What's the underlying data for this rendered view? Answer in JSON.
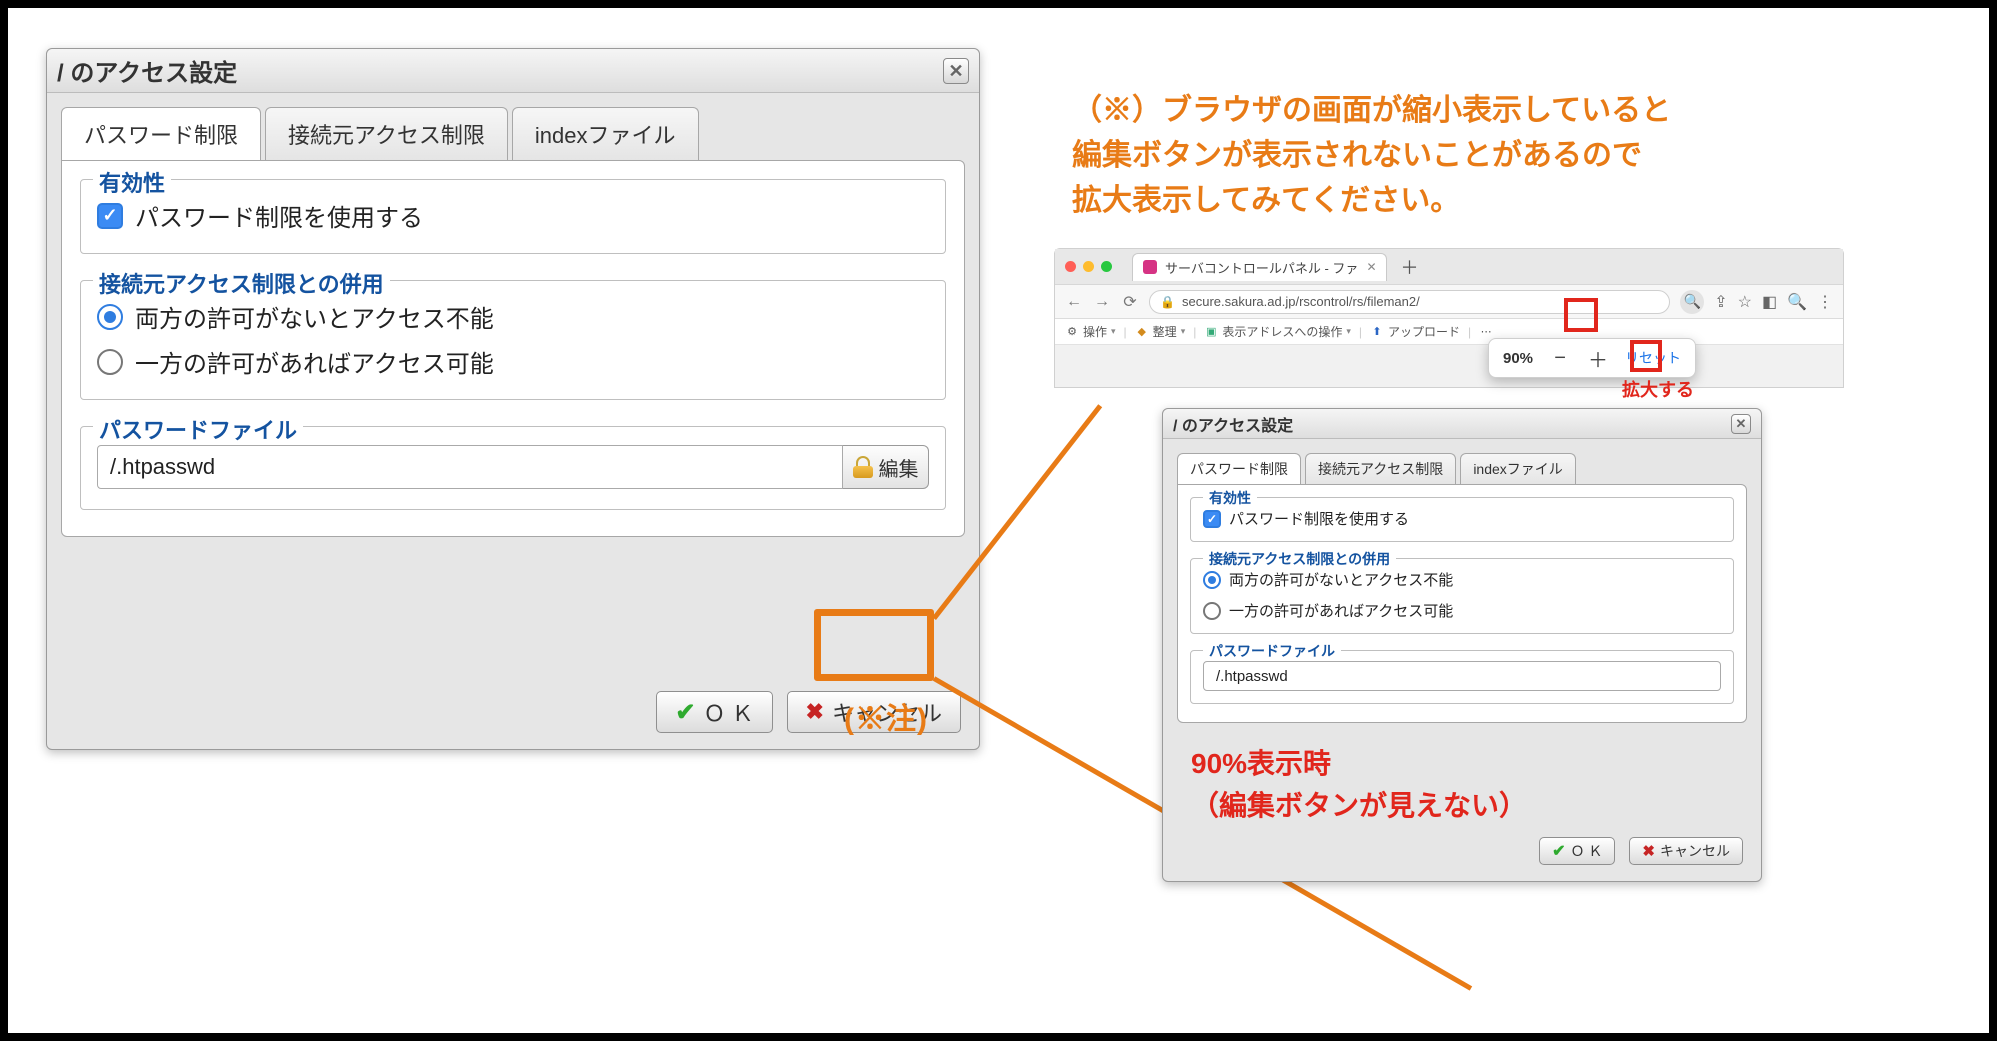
{
  "left_dialog": {
    "title": "/ のアクセス設定",
    "tabs": [
      "パスワード制限",
      "接続元アクセス制限",
      "indexファイル"
    ],
    "validity": {
      "legend": "有効性",
      "checkbox_label": "パスワード制限を使用する"
    },
    "combined": {
      "legend": "接続元アクセス制限との併用",
      "opt1": "両方の許可がないとアクセス不能",
      "opt2": "一方の許可があればアクセス可能"
    },
    "pwfile": {
      "legend": "パスワードファイル",
      "value": "/.htpasswd",
      "edit": "編集"
    },
    "ok": "Ｏ Ｋ",
    "cancel": "キャンセル"
  },
  "note_label": "(※注)",
  "warning": {
    "l1": "（※）ブラウザの画面が縮小表示していると",
    "l2": "編集ボタンが表示されないことがあるので",
    "l3": "拡大表示してみてください。"
  },
  "browser": {
    "tab_title": "サーバコントロールパネル - ファ",
    "url": "secure.sakura.ad.jp/rscontrol/rs/fileman2/",
    "toolbar": {
      "a": "操作",
      "b": "整理",
      "c": "表示アドレスへの操作",
      "d": "アップロード"
    },
    "zoom": {
      "pct": "90%",
      "reset": "リセット"
    },
    "enlarge_label": "拡大する"
  },
  "right_dialog": {
    "title": "/ のアクセス設定",
    "tabs": [
      "パスワード制限",
      "接続元アクセス制限",
      "indexファイル"
    ],
    "validity": {
      "legend": "有効性",
      "checkbox_label": "パスワード制限を使用する"
    },
    "combined": {
      "legend": "接続元アクセス制限との併用",
      "opt1": "両方の許可がないとアクセス不能",
      "opt2": "一方の許可があればアクセス可能"
    },
    "pwfile": {
      "legend": "パスワードファイル",
      "value": "/.htpasswd"
    },
    "ok": "Ｏ Ｋ",
    "cancel": "キャンセル"
  },
  "red_caption": {
    "l1": "90%表示時",
    "l2": "（編集ボタンが見えない）"
  }
}
